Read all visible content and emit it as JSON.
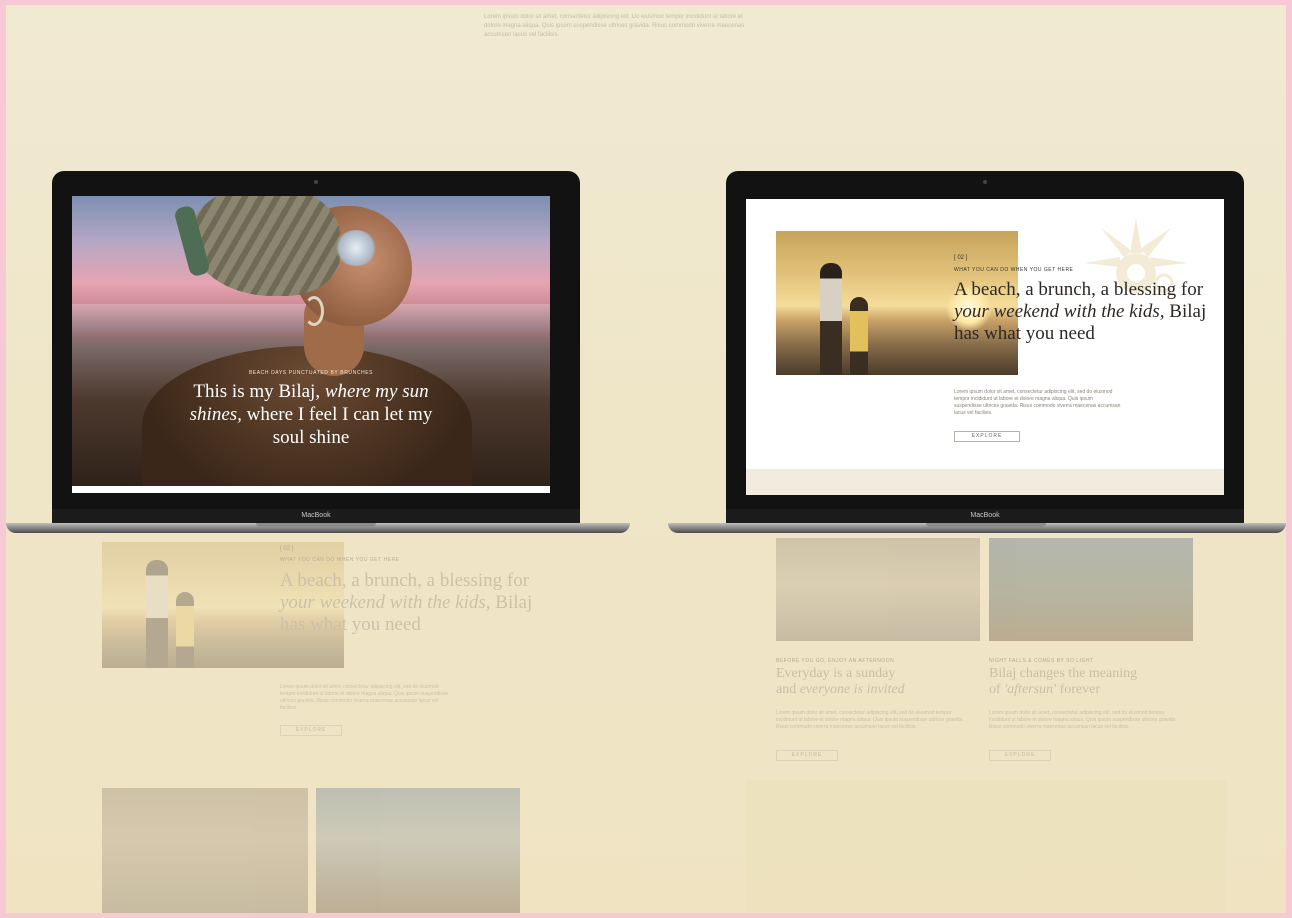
{
  "top_blurb": "Lorem ipsum dolor sit amet, consectetur adipiscing elit. Do eiusmod tempor incididunt ut labore et dolore magna aliqua. Quis ipsum suspendisse ultrices gravida. Risus commodo viverra maecenas accumsan lacus vel facilisis.",
  "laptop_left": {
    "brand": "MacBook",
    "hero": {
      "eyebrow": "BEACH DAYS PUNCTUATED BY BRUNCHES",
      "title_a": "This is my Bilaj,",
      "title_b": "where my sun shines,",
      "title_c": "where I feel I can let my soul shine"
    }
  },
  "laptop_right": {
    "brand": "MacBook",
    "section": {
      "number": "[ 02 ]",
      "eyebrow": "WHAT YOU CAN DO WHEN YOU GET HERE",
      "title_a": "A beach, a brunch, a blessing for",
      "title_b": "your weekend with the kids,",
      "title_c": "Bilaj has what you need",
      "body": "Lorem ipsum dolor sit amet, consectetur adipiscing elit, sed do eiusmod tempor incididunt ut labore et dolore magna aliqua. Quis ipsum suspendisse ultrices gravida. Risus commodo viverra maecenas accumsan lacus vel facilisis.",
      "button": "EXPLORE"
    }
  },
  "background_left": {
    "number": "[ 02 ]",
    "eyebrow": "WHAT YOU CAN DO WHEN YOU GET HERE",
    "title_a": "A beach, a brunch, a blessing for",
    "title_b": "your weekend with the kids,",
    "title_c": "Bilaj has what you need",
    "body": "Lorem ipsum dolor sit amet, consectetur adipiscing elit, sed do eiusmod tempor incididunt ut labore et dolore magna aliqua. Quis ipsum suspendisse ultrices gravida. Risus commodo viverra maecenas accumsan lacus vel facilisis.",
    "button": "EXPLORE"
  },
  "background_right": {
    "card1": {
      "eyebrow": "BEFORE YOU GO, ENJOY AN AFTERNOON",
      "title_a": "Everyday is a sunday",
      "title_b": "and",
      "title_c": "everyone is invited",
      "body": "Lorem ipsum dolor sit amet, consectetur adipiscing elit, sed do eiusmod tempor incididunt ut labore et dolore magna aliqua. Quis ipsum suspendisse ultrices gravida. Risus commodo viverra maecenas accumsan lacus vel facilisis.",
      "button": "EXPLORE"
    },
    "card2": {
      "eyebrow": "NIGHT FALLS & COMES BY SO LIGHT",
      "title_a": "Bilaj changes the meaning",
      "title_b": "of",
      "title_c": "'aftersun'",
      "title_d": "forever",
      "body": "Lorem ipsum dolor sit amet, consectetur adipiscing elit, sed do eiusmod tempor incididunt ut labore et dolore magna aliqua. Quis ipsum suspendisse ultrices gravida. Risus commodo viverra maecenas accumsan lacus vel facilisis.",
      "button": "EXPLORE"
    }
  },
  "colors": {
    "page_frame": "#f6c9d4",
    "background": "#efe6c8",
    "laptop": "#121212",
    "ink": "#2e2824"
  }
}
